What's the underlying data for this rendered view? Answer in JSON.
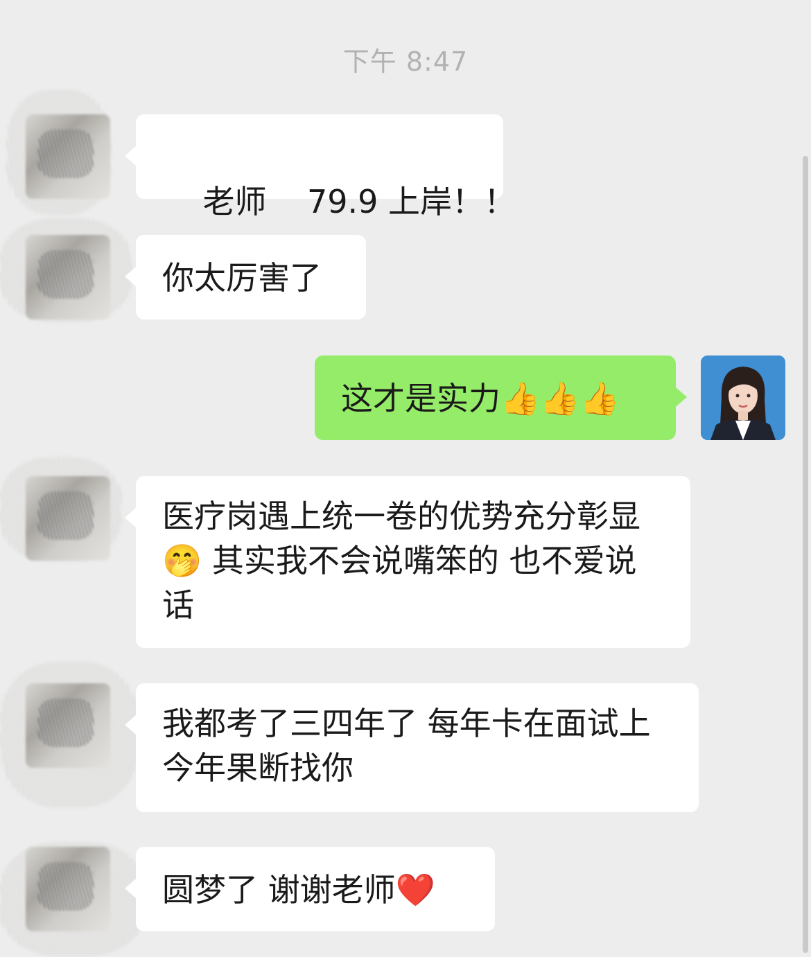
{
  "chat": {
    "timestamp": "下午 8:47",
    "messages": [
      {
        "from": "contact",
        "text": "老师    79.9 上岸！！"
      },
      {
        "from": "contact",
        "text": "你太厉害了"
      },
      {
        "from": "me",
        "text": "这才是实力👍👍👍"
      },
      {
        "from": "contact",
        "text": "医疗岗遇上统一卷的优势充分彰显🤭 其实我不会说嘴笨的 也不爱说话"
      },
      {
        "from": "contact",
        "text": "我都考了三四年了 每年卡在面试上 今年果断找你"
      },
      {
        "from": "contact",
        "text": "圆梦了 谢谢老师❤️"
      }
    ]
  },
  "colors": {
    "background": "#ededed",
    "incoming_bubble": "#ffffff",
    "outgoing_bubble": "#95ec69",
    "timestamp": "#b2b2b2"
  }
}
